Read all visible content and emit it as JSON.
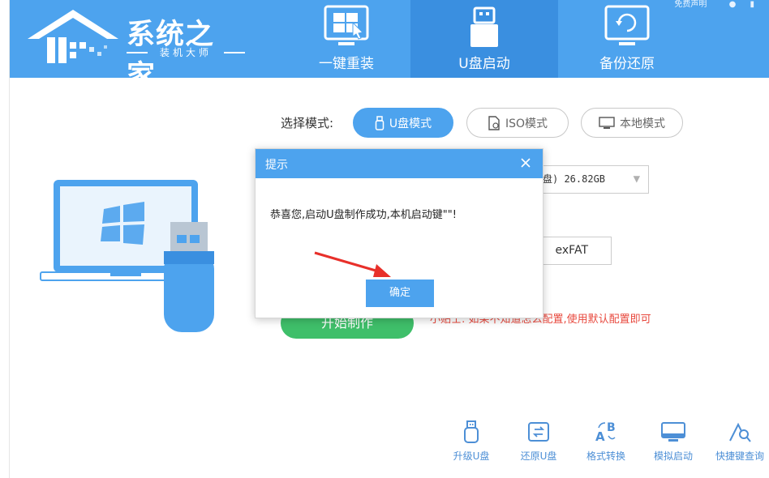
{
  "header": {
    "logo_title": "系统之家",
    "logo_subtitle": "装机大师",
    "top_right_text": "免费声明",
    "tabs": [
      {
        "label": "一键重装",
        "icon": "windows-install-icon"
      },
      {
        "label": "U盘启动",
        "icon": "usb-drive-icon"
      },
      {
        "label": "备份还原",
        "icon": "backup-restore-icon"
      }
    ],
    "active_tab": "U盘启动"
  },
  "main": {
    "mode_label": "选择模式:",
    "modes": [
      {
        "label": "U盘模式",
        "icon": "usb-icon",
        "selected": true
      },
      {
        "label": "ISO模式",
        "icon": "iso-file-icon",
        "selected": false
      },
      {
        "label": "本地模式",
        "icon": "monitor-icon",
        "selected": false
      }
    ],
    "drive_select_value": "盘) 26.82GB",
    "filesystem_value": "exFAT",
    "start_button_label": "开始制作",
    "hint_text": "小贴士: 如果不知道怎么配置,使用默认配置即可"
  },
  "tools": [
    {
      "label": "升级U盘",
      "icon": "usb-upgrade-icon"
    },
    {
      "label": "还原U盘",
      "icon": "usb-restore-icon"
    },
    {
      "label": "格式转换",
      "icon": "format-convert-icon"
    },
    {
      "label": "模拟启动",
      "icon": "simulate-boot-icon"
    },
    {
      "label": "快捷键查询",
      "icon": "shortcut-search-icon"
    }
  ],
  "dialog": {
    "title": "提示",
    "message": "恭喜您,启动U盘制作成功,本机启动键\"\"!",
    "ok_label": "确定"
  },
  "colors": {
    "brand_blue": "#4da3ee",
    "active_tab_blue": "#3a8fe0",
    "start_green": "#3fbf6a",
    "hint_red": "#e84a3f",
    "tool_label_blue": "#4d8fd6"
  }
}
